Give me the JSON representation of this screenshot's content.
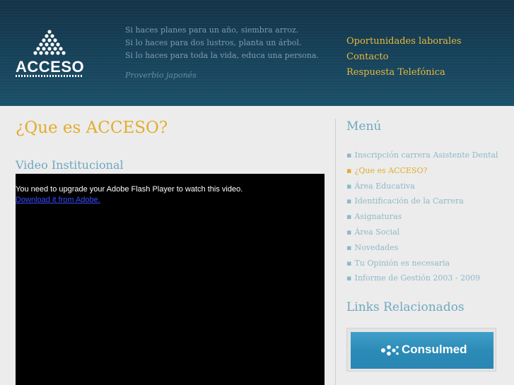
{
  "header": {
    "logo_text": "ACCESO",
    "quote_lines": [
      "Si haces planes para un año, siembra arroz.",
      "Si lo haces para dos lustros, planta un árbol.",
      "Si lo haces para toda la vida, educa una persona."
    ],
    "quote_author": "Proverbio japonés",
    "links": [
      "Oportunidades laborales",
      "Contacto",
      "Respuesta Telefónica"
    ]
  },
  "main": {
    "title": "¿Que es ACCESO?",
    "video_title": "Video Institucional",
    "flash_message": "You need to upgrade your Adobe Flash Player to watch this video.",
    "flash_link": "Download it from Adobe."
  },
  "sidebar": {
    "menu_title": "Menú",
    "menu_items": [
      "Inscripción carrera Asistente Dental",
      "¿Que es ACCESO?",
      "Área Educativa",
      "Identificación de la Carrera",
      "Asignaturas",
      "Área Social",
      "Novedades",
      "Tu Opinión es necesaria",
      "Informe de Gestión 2003 - 2009"
    ],
    "active_index": 1,
    "links_title": "Links Relacionados",
    "banner_text": "Consulmed"
  },
  "colors": {
    "header_bg": "#16425a",
    "accent_gold": "#e2ad2c",
    "accent_blue": "#6fa8bf",
    "banner_blue": "#2b8ab6"
  }
}
